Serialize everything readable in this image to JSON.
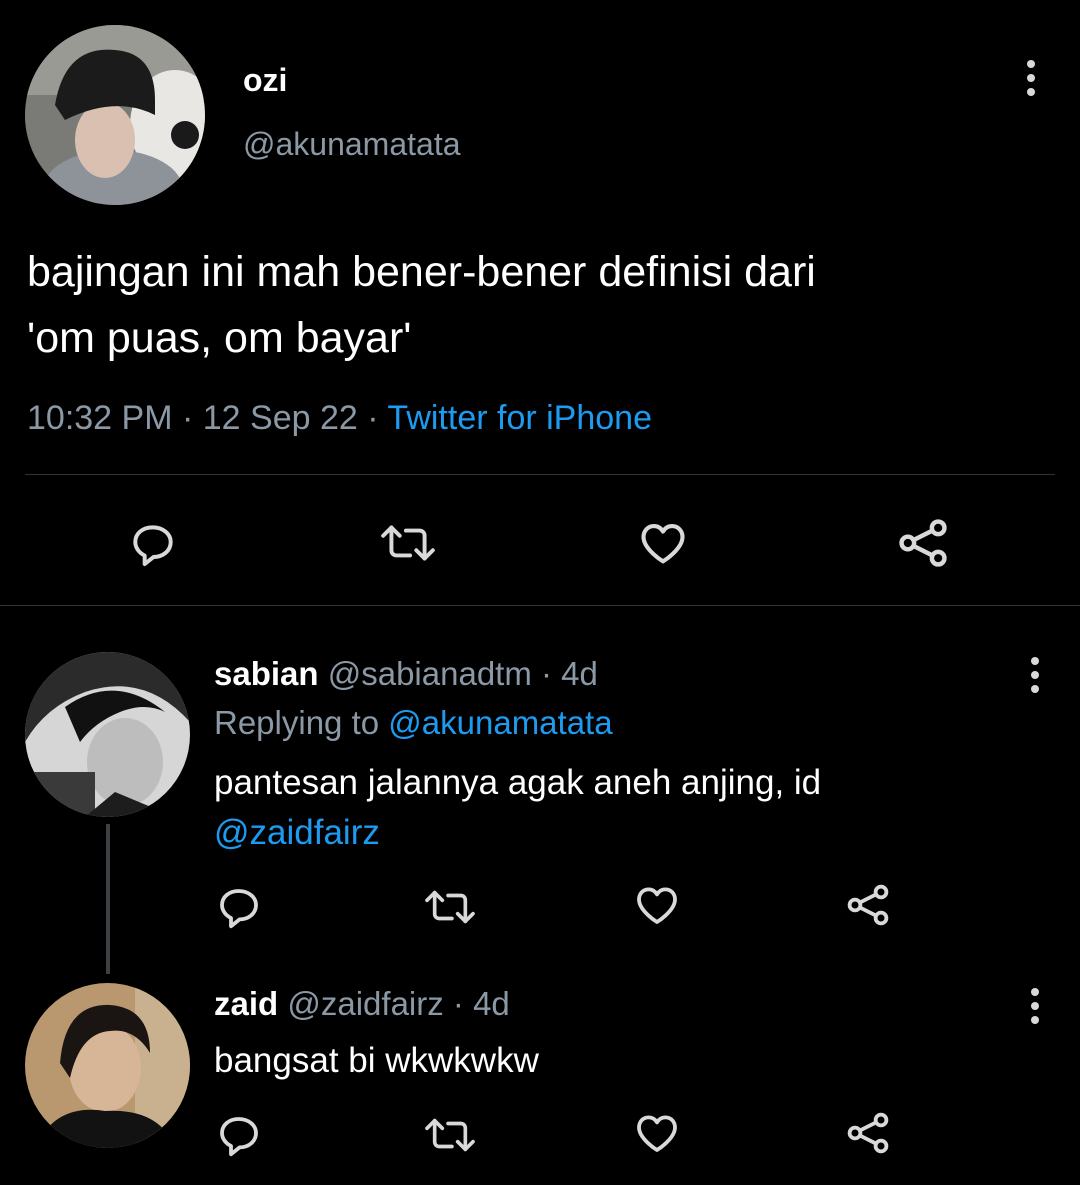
{
  "main_tweet": {
    "author": {
      "name": "ozi",
      "handle": "@akunamatata"
    },
    "text_line1": "bajingan ini mah bener-bener definisi dari",
    "text_line2": "'om puas, om bayar'",
    "time": "10:32 PM",
    "date": "12 Sep 22",
    "separator": "·",
    "source": "Twitter for iPhone",
    "icons": [
      "reply-icon",
      "retweet-icon",
      "like-icon",
      "share-icon"
    ]
  },
  "replies": [
    {
      "name": "sabian",
      "handle": "@sabianadtm",
      "age": "· 4d",
      "replying_prefix": "Replying to",
      "replying_to": "@akunamatata",
      "text_line1": "pantesan jalannya agak aneh anjing, id",
      "mention": "@zaidfairz"
    },
    {
      "name": "zaid",
      "handle": "@zaidfairz",
      "age": "· 4d",
      "text_line1": "bangsat bi wkwkwkw"
    }
  ],
  "colors": {
    "background": "#000000",
    "text": "#ffffff",
    "muted": "#8b98a5",
    "link": "#1d9bf0",
    "divider": "#2f3336"
  }
}
